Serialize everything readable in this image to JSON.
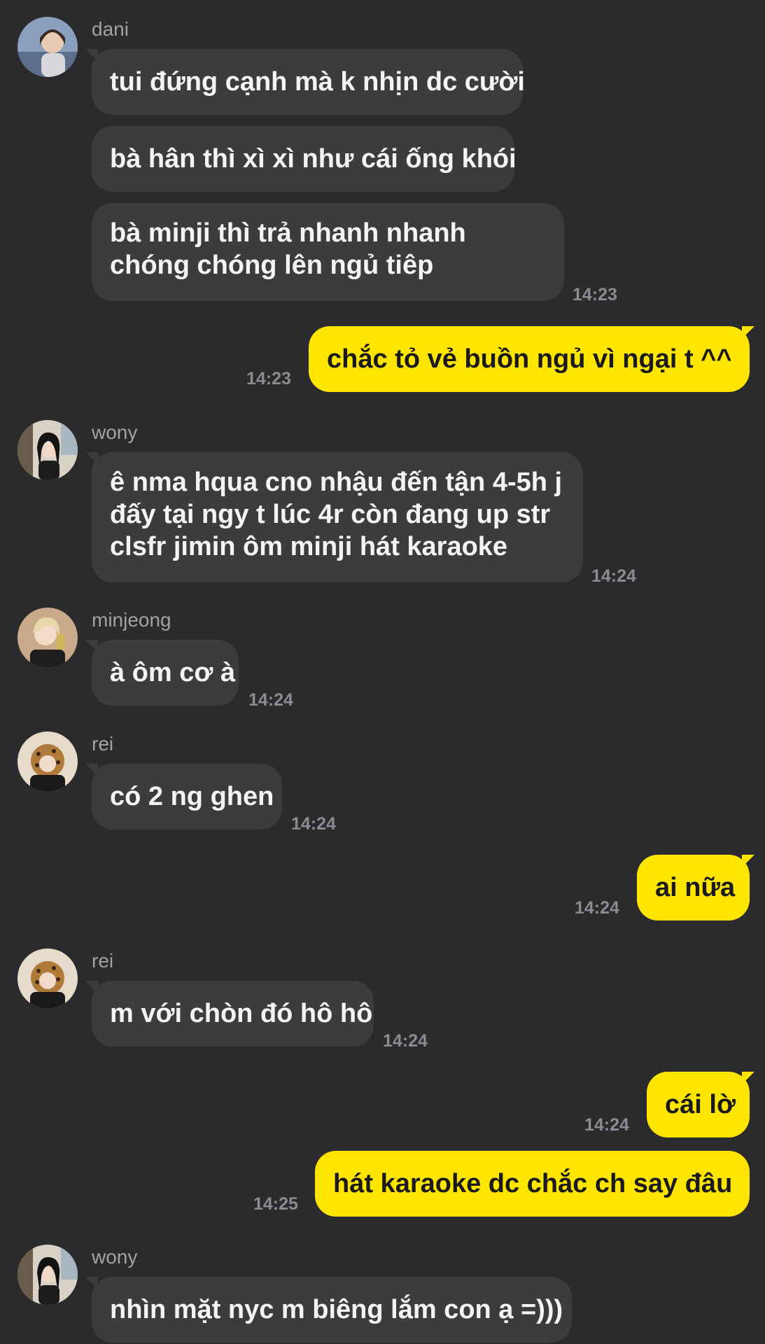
{
  "colors": {
    "background": "#2b2b2d",
    "incoming_bubble": "#3c3c3f",
    "outgoing_bubble": "#fee500",
    "sender_name": "#a3a3a6",
    "timestamp": "#8c8c90"
  },
  "messages": [
    {
      "sender": "dani",
      "texts": [
        "tui đứng cạnh mà k nhịn dc cười",
        "bà hân thì xì xì như cái ống khói",
        "bà minji thì trả nhanh nhanh chóng chóng lên ngủ tiêp"
      ],
      "time": "14:23"
    },
    {
      "sender": "me",
      "texts": [
        "chắc tỏ vẻ buồn ngủ vì ngại t ^^"
      ],
      "time": "14:23"
    },
    {
      "sender": "wony",
      "texts": [
        "ê nma hqua cno nhậu đến tận 4-5h j đấy tại ngy t lúc 4r còn đang up str clsfr jimin ôm minji hát karaoke"
      ],
      "time": "14:24"
    },
    {
      "sender": "minjeong",
      "texts": [
        "à ôm cơ à"
      ],
      "time": "14:24"
    },
    {
      "sender": "rei",
      "texts": [
        "có 2 ng ghen"
      ],
      "time": "14:24"
    },
    {
      "sender": "me",
      "texts": [
        "ai nữa"
      ],
      "time": "14:24"
    },
    {
      "sender": "rei",
      "texts": [
        "m với chòn đó hô hô"
      ],
      "time": "14:24"
    },
    {
      "sender": "me",
      "texts": [
        "cái lờ"
      ],
      "time": "14:24"
    },
    {
      "sender": "me",
      "texts": [
        "hát karaoke dc chắc ch say đâu"
      ],
      "time": "14:25"
    },
    {
      "sender": "wony",
      "texts": [
        "nhìn mặt nyc m biêng lắm con ạ =)))"
      ],
      "time": ""
    }
  ]
}
